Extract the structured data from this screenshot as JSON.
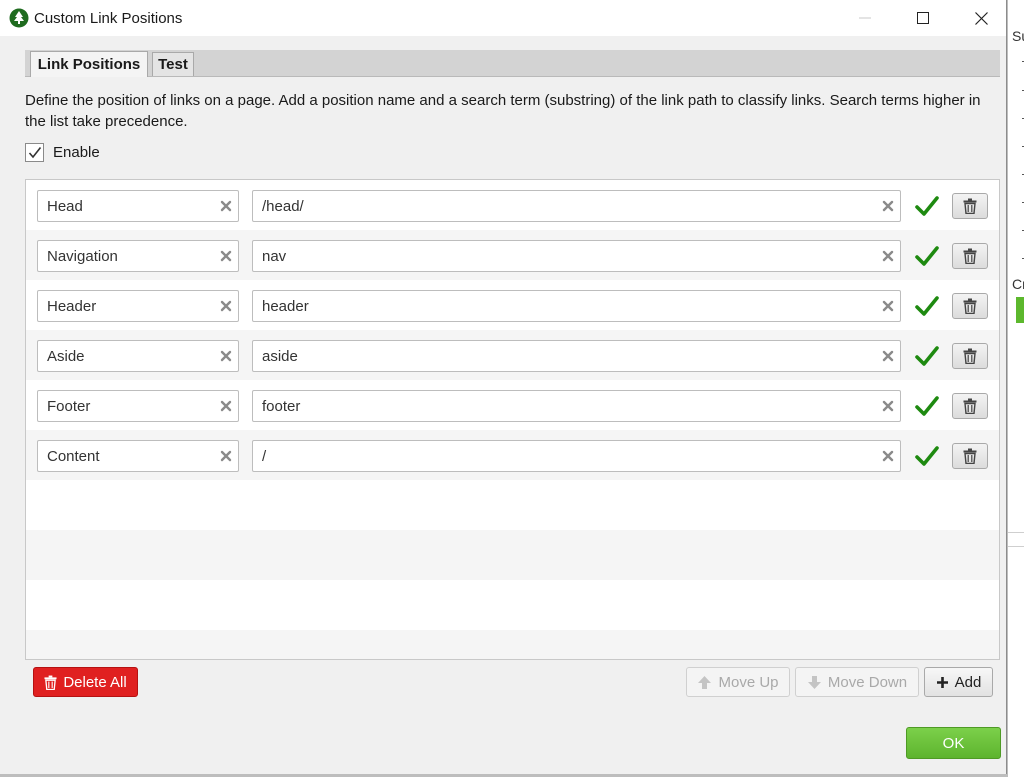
{
  "window": {
    "title": "Custom Link Positions",
    "icon": "tree-app-icon"
  },
  "tabs": [
    {
      "label": "Link Positions",
      "active": true
    },
    {
      "label": "Test",
      "active": false
    }
  ],
  "description": "Define the position of links on a page. Add a position name and a search term (substring) of the link path to classify links. Search terms higher in the list take precedence.",
  "enable": {
    "label": "Enable",
    "checked": true
  },
  "positions": [
    {
      "name": "Head",
      "term": "/head/"
    },
    {
      "name": "Navigation",
      "term": "nav"
    },
    {
      "name": "Header",
      "term": "header"
    },
    {
      "name": "Aside",
      "term": "aside"
    },
    {
      "name": "Footer",
      "term": "footer"
    },
    {
      "name": "Content",
      "term": "/"
    }
  ],
  "toolbar": {
    "delete_all": "Delete All",
    "move_up": "Move Up",
    "move_down": "Move Down",
    "add": "Add"
  },
  "ok_label": "OK",
  "background_app": {
    "fragments": [
      "Su",
      "Cra"
    ]
  },
  "colors": {
    "danger": "#e02020",
    "success": "#5db42e",
    "check_ok": "#1e8a10"
  }
}
